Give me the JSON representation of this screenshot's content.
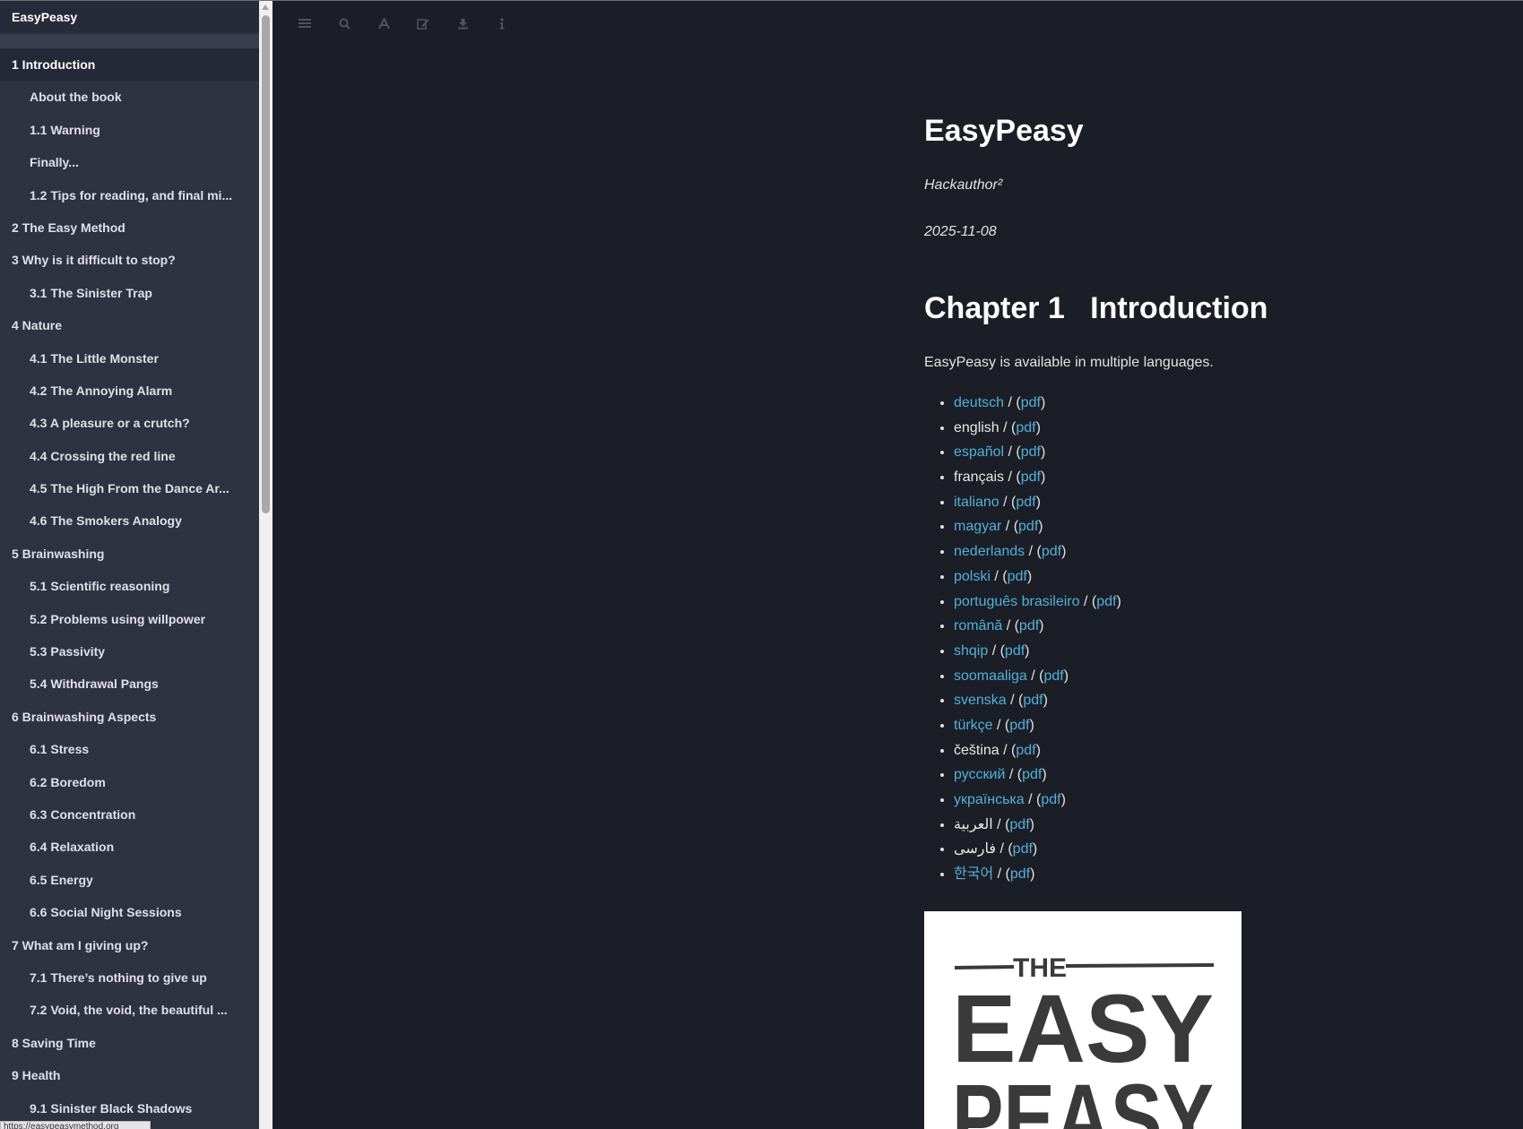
{
  "sidebar": {
    "title": "EasyPeasy",
    "items": [
      {
        "label": "1 Introduction",
        "level": 1,
        "active": true
      },
      {
        "label": "About the book",
        "level": 2
      },
      {
        "label": "1.1 Warning",
        "level": 2
      },
      {
        "label": "Finally...",
        "level": 2
      },
      {
        "label": "1.2 Tips for reading, and final mi...",
        "level": 2
      },
      {
        "label": "2 The Easy Method",
        "level": 1
      },
      {
        "label": "3 Why is it difficult to stop?",
        "level": 1
      },
      {
        "label": "3.1 The Sinister Trap",
        "level": 2
      },
      {
        "label": "4 Nature",
        "level": 1
      },
      {
        "label": "4.1 The Little Monster",
        "level": 2
      },
      {
        "label": "4.2 The Annoying Alarm",
        "level": 2
      },
      {
        "label": "4.3 A pleasure or a crutch?",
        "level": 2
      },
      {
        "label": "4.4 Crossing the red line",
        "level": 2
      },
      {
        "label": "4.5 The High From the Dance Ar...",
        "level": 2
      },
      {
        "label": "4.6 The Smokers Analogy",
        "level": 2
      },
      {
        "label": "5 Brainwashing",
        "level": 1
      },
      {
        "label": "5.1 Scientific reasoning",
        "level": 2
      },
      {
        "label": "5.2 Problems using willpower",
        "level": 2
      },
      {
        "label": "5.3 Passivity",
        "level": 2
      },
      {
        "label": "5.4 Withdrawal Pangs",
        "level": 2
      },
      {
        "label": "6 Brainwashing Aspects",
        "level": 1
      },
      {
        "label": "6.1 Stress",
        "level": 2
      },
      {
        "label": "6.2 Boredom",
        "level": 2
      },
      {
        "label": "6.3 Concentration",
        "level": 2
      },
      {
        "label": "6.4 Relaxation",
        "level": 2
      },
      {
        "label": "6.5 Energy",
        "level": 2
      },
      {
        "label": "6.6 Social Night Sessions",
        "level": 2
      },
      {
        "label": "7 What am I giving up?",
        "level": 1
      },
      {
        "label": "7.1 There’s nothing to give up",
        "level": 2
      },
      {
        "label": "7.2 Void, the void, the beautiful ...",
        "level": 2
      },
      {
        "label": "8 Saving Time",
        "level": 1
      },
      {
        "label": "9 Health",
        "level": 1
      },
      {
        "label": "9.1 Sinister Black Shadows",
        "level": 2
      }
    ]
  },
  "toolbar": {
    "icons": [
      "menu-icon",
      "search-icon",
      "font-icon",
      "edit-icon",
      "download-icon",
      "info-icon"
    ]
  },
  "book": {
    "title": "EasyPeasy",
    "author": "Hackauthor²",
    "date": "2025-11-08",
    "chapter_heading": "Chapter 1   Introduction",
    "intro_text": "EasyPeasy is available in multiple languages.",
    "separator": " / (",
    "pdf_label": "pdf",
    "close_paren": ")",
    "languages": [
      {
        "name": "deutsch",
        "link": true
      },
      {
        "name": "english",
        "link": false
      },
      {
        "name": "español",
        "link": true
      },
      {
        "name": "français",
        "link": false
      },
      {
        "name": "italiano",
        "link": true
      },
      {
        "name": "magyar",
        "link": true
      },
      {
        "name": "nederlands",
        "link": true
      },
      {
        "name": "polski",
        "link": true
      },
      {
        "name": "português brasileiro",
        "link": true
      },
      {
        "name": "română",
        "link": true
      },
      {
        "name": "shqip",
        "link": true
      },
      {
        "name": "soomaaliga",
        "link": true
      },
      {
        "name": "svenska",
        "link": true
      },
      {
        "name": "türkçe",
        "link": true
      },
      {
        "name": "čeština",
        "link": false
      },
      {
        "name": "русский",
        "link": true
      },
      {
        "name": "українська",
        "link": true
      },
      {
        "name": "العربية",
        "link": false
      },
      {
        "name": "فارسی",
        "link": false
      },
      {
        "name": "한국어",
        "link": true
      }
    ],
    "cover": {
      "text_the": "THE",
      "text_easy": "EASY",
      "text_peasy": "PEASY"
    }
  },
  "status_bar": {
    "url": "https://easypeasymethod.org"
  },
  "colors": {
    "background": "#1c1e27",
    "sidebar": "#2f3241",
    "link": "#4fb1d9"
  }
}
